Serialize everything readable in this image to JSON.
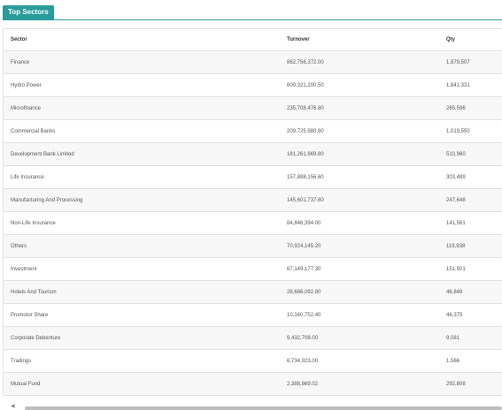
{
  "tab": {
    "label": "Top Sectors"
  },
  "table": {
    "headers": [
      "Sector",
      "Turnover",
      "Qty"
    ],
    "rows": [
      [
        "Finance",
        "862,756,372.00",
        "1,879,507"
      ],
      [
        "Hydro Power",
        "609,321,200.50",
        "1,841,331"
      ],
      [
        "Microfinance",
        "235,708,476.80",
        "265,596"
      ],
      [
        "Commercial Banks",
        "209,725,980.80",
        "1,019,550"
      ],
      [
        "Development Bank Limited",
        "181,261,969.80",
        "510,960"
      ],
      [
        "Life Insurance",
        "157,888,156.60",
        "303,489"
      ],
      [
        "Manufacturing And Processing",
        "145,601,737.60",
        "247,648"
      ],
      [
        "Non-Life Insurance",
        "84,846,394.00",
        "141,561"
      ],
      [
        "Others",
        "70,924,145.20",
        "119,938"
      ],
      [
        "Investment",
        "67,149,177.30",
        "151,901"
      ],
      [
        "Hotels And Tourism",
        "28,686,092.80",
        "46,849"
      ],
      [
        "Promotor Share",
        "10,160,752.40",
        "46,375"
      ],
      [
        "Corporate Debenture",
        "9,432,708.00",
        "9,081"
      ],
      [
        "Tradings",
        "6,734,923.00",
        "1,566"
      ],
      [
        "Mutual Fund",
        "2,388,869.02",
        "292,808"
      ]
    ]
  },
  "colors": {
    "accent": "#2a9b9b"
  },
  "icons": {
    "scroll_left": "chevron-left-icon"
  }
}
